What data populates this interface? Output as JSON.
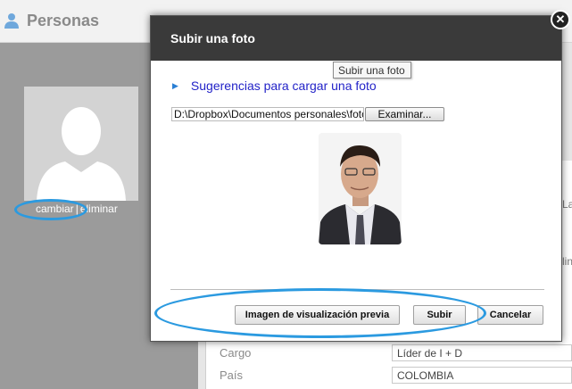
{
  "app": {
    "title": "Personas",
    "icon": "person-icon"
  },
  "avatar": {
    "change_label": "cambiar",
    "separator": "|",
    "delete_label": "eliminar"
  },
  "form": {
    "cargo_label": "Cargo",
    "cargo_value": "Líder de I + D",
    "pais_label": "País",
    "pais_value": "COLOMBIA",
    "edge_chars": [
      "La",
      "lin"
    ]
  },
  "modal": {
    "title": "Subir una foto",
    "close_icon": "close-icon",
    "tooltip": "Subir una foto",
    "tips_link": "Sugerencias para cargar una foto",
    "file_path": "D:\\Dropbox\\Documentos personales\\foto",
    "browse_label": "Examinar...",
    "preview_button": "Imagen de visualización previa",
    "upload_button": "Subir",
    "cancel_button": "Cancelar"
  },
  "colors": {
    "modal_header": "#3a3a3a",
    "link": "#2323c8",
    "highlight": "#2b9ae0",
    "side_panel": "#9b9b9b"
  }
}
